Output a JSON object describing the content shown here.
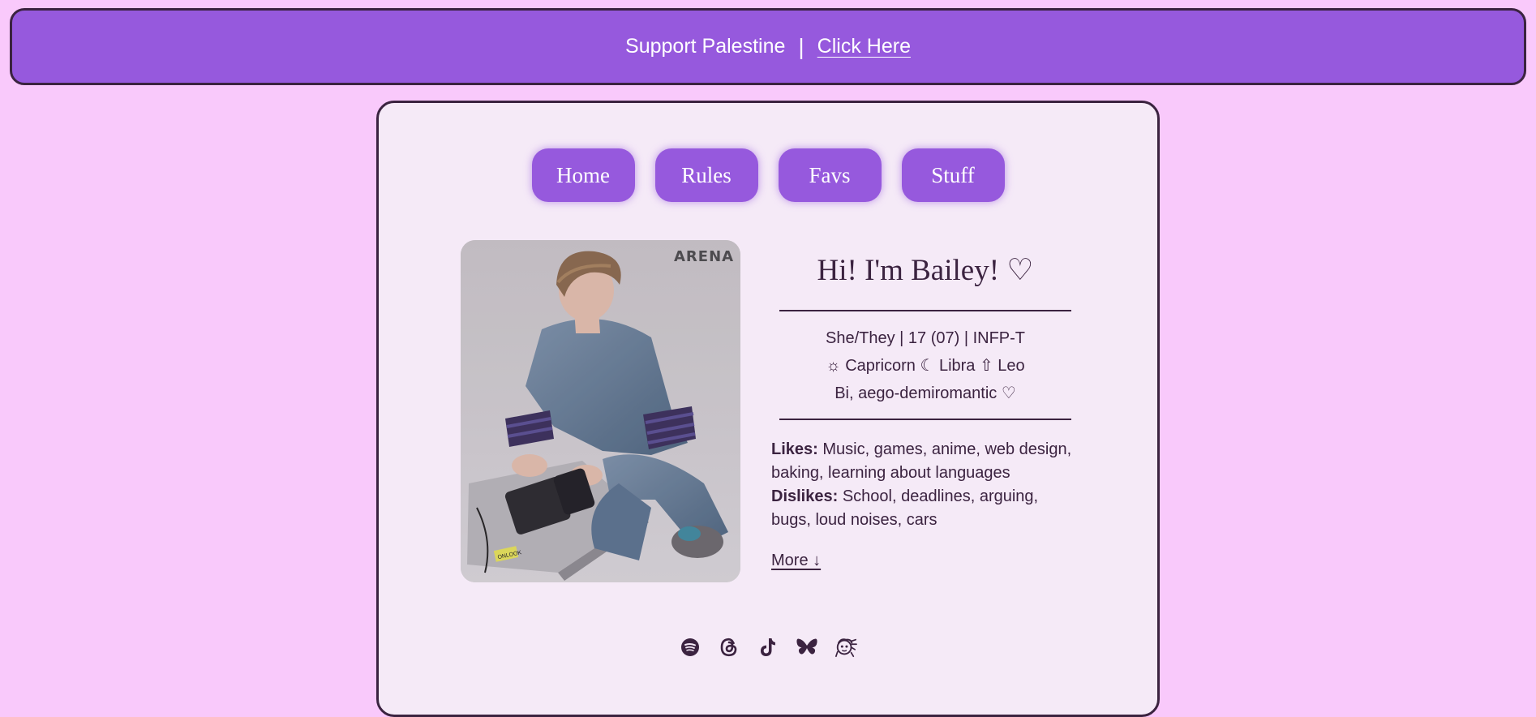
{
  "banner": {
    "text": "Support Palestine",
    "separator": "|",
    "link": "Click Here"
  },
  "nav": [
    "Home",
    "Rules",
    "Favs",
    "Stuff"
  ],
  "photo": {
    "watermark": "ARENA",
    "label": "ONLOOK"
  },
  "profile": {
    "greeting": "Hi! I'm Bailey! ♡",
    "line1": "She/They | 17 (07) | INFP-T",
    "line2": "☼ Capricorn ☾ Libra ⇧ Leo",
    "line3": "Bi, aego-demiromantic ♡",
    "likes_label": "Likes:",
    "likes": " Music, games, anime, web design, baking, learning about languages",
    "dislikes_label": "Dislikes:",
    "dislikes": " School, deadlines, arguing, bugs, loud noises, cars",
    "more": "More ↓"
  },
  "socials": [
    "spotify-icon",
    "threads-icon",
    "tiktok-icon",
    "bluesky-icon",
    "character-icon"
  ],
  "colors": {
    "background": "#f9c9fb",
    "accent": "#9659dd",
    "card": "#f5eaf7",
    "ink": "#3b2340"
  }
}
